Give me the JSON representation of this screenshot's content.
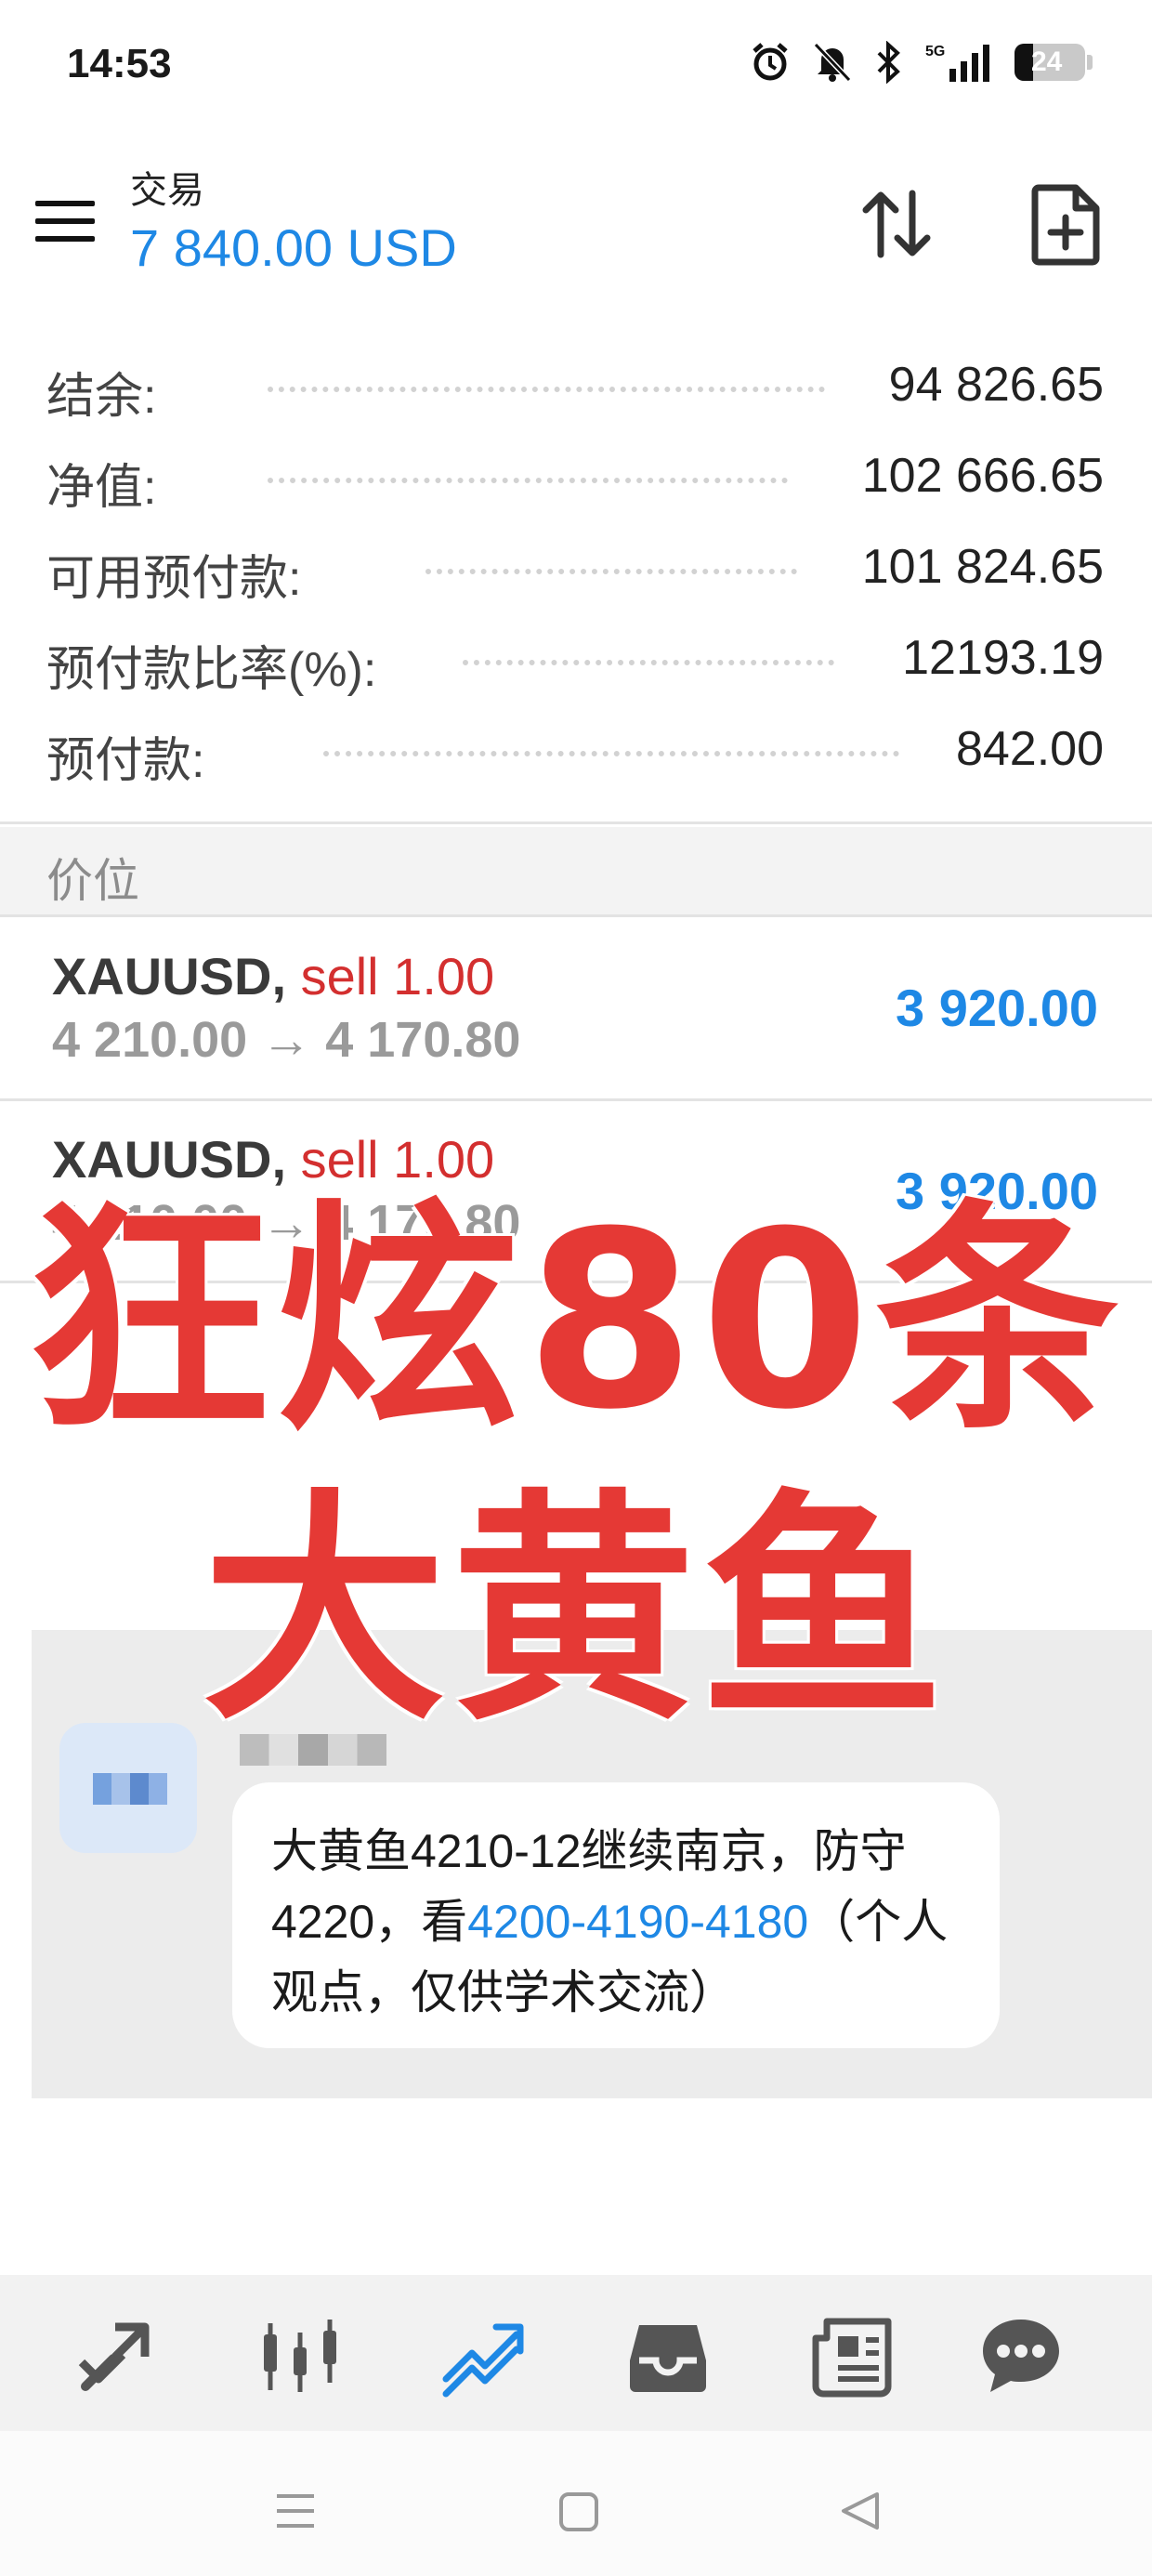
{
  "status_bar": {
    "time": "14:53",
    "network": "5G",
    "battery": "24",
    "icons": [
      "alarm-icon",
      "mute-icon",
      "bluetooth-icon",
      "signal-5g-icon",
      "battery-icon"
    ]
  },
  "header": {
    "title": "交易",
    "balance": "7 840.00 USD",
    "icons": [
      "menu-icon",
      "sort-icon",
      "new-order-icon"
    ]
  },
  "account": [
    {
      "label": "结余:",
      "value": "94 826.65"
    },
    {
      "label": "净值:",
      "value": "102 666.65"
    },
    {
      "label": "可用预付款:",
      "value": "101 824.65"
    },
    {
      "label": "预付款比率(%):",
      "value": "12193.19"
    },
    {
      "label": "预付款:",
      "value": "842.00"
    }
  ],
  "section": {
    "label": "价位"
  },
  "orders": [
    {
      "symbol": "XAUUSD,",
      "direction": "sell 1.00",
      "open_price": "4 210.00",
      "arrow": "→",
      "current_price": "4 170.80",
      "profit": "3 920.00"
    },
    {
      "symbol": "XAUUSD,",
      "direction": "sell 1.00",
      "open_price": "4 210.00",
      "arrow": "→",
      "current_price": "4 170.80",
      "profit": "3 920.00"
    }
  ],
  "overlay": {
    "line1": "狂炫80条",
    "line2": "大黄鱼"
  },
  "chat": {
    "message_part1": "大黄鱼4210-12继续南京，防守4220，看",
    "message_highlight": "4200-4190-4180",
    "message_part2": "（个人观点，仅供学术交流）"
  },
  "tabbar": {
    "items": [
      "quotes-icon",
      "chart-icon",
      "trade-icon",
      "history-icon",
      "news-icon",
      "messages-icon"
    ],
    "active": "trade-icon"
  },
  "colors": {
    "accent": "#1e88e5",
    "sell": "#d32f2f",
    "overlay": "#e53935",
    "muted": "#9a9a9a"
  }
}
